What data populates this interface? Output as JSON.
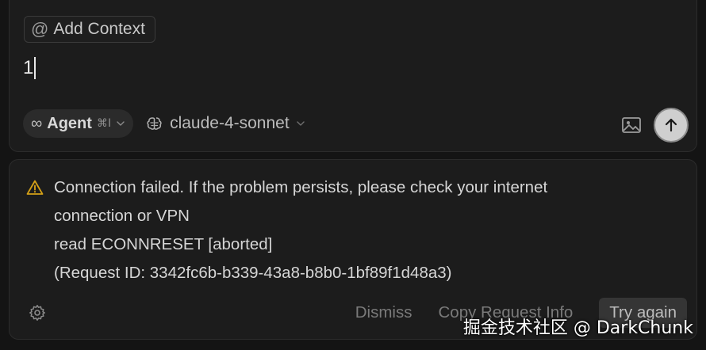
{
  "composer": {
    "add_context_symbol": "@",
    "add_context_label": "Add Context",
    "input_value": "1",
    "mode": {
      "icon": "infinity-icon",
      "label": "Agent",
      "shortcut": "⌘I"
    },
    "model": {
      "icon": "brain-icon",
      "label": "claude-4-sonnet"
    },
    "image_button_icon": "image-icon",
    "send_button_icon": "arrow-up-icon"
  },
  "error": {
    "icon": "warning-triangle-icon",
    "lines": [
      "Connection failed. If the problem persists, please check your internet",
      "connection or VPN",
      "read ECONNRESET [aborted]",
      "(Request ID: 3342fc6b-b339-43a8-b8b0-1bf89f1d48a3)"
    ],
    "settings_icon": "gear-icon",
    "actions": {
      "dismiss": "Dismiss",
      "copy_request_info": "Copy Request Info",
      "try_again": "Try again"
    }
  },
  "watermark": "掘金技术社区 @ DarkChunk",
  "colors": {
    "background": "#141414",
    "panel": "#1c1c1c",
    "send_button": "#cfcfcf"
  }
}
